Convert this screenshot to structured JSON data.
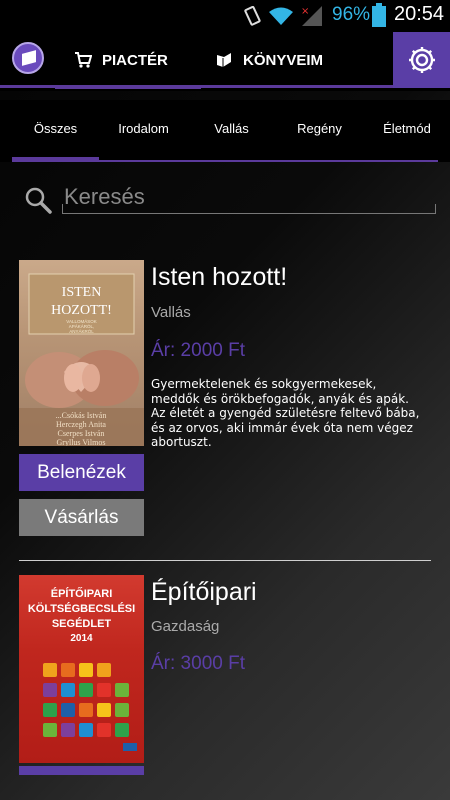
{
  "status_bar": {
    "battery_percent": "96%",
    "time": "20:54"
  },
  "action_bar": {
    "tabs": [
      {
        "label": "PIACTÉR",
        "icon": "cart-icon"
      },
      {
        "label": "KÖNYVEIM",
        "icon": "book-icon"
      }
    ],
    "settings_icon": "gear-icon"
  },
  "categories": [
    "Összes",
    "Irodalom",
    "Vallás",
    "Regény",
    "Életmód"
  ],
  "search": {
    "placeholder": "Keresés"
  },
  "books": [
    {
      "title": "Isten hozott!",
      "category": "Vallás",
      "price": "Ár: 2000 Ft",
      "description": "Gyermektelenek és sokgyermekesek, meddők és örökbefogadók, anyák és apák. Az életét a gyengéd születésre feltevő bába, és az orvos, aki immár évek óta nem végez abortuszt.",
      "preview_label": "Belenézek",
      "buy_label": "Vásárlás",
      "cover": {
        "title_line1": "ISTEN",
        "title_line2": "HOZOTT!",
        "subtitle_line1": "VALLOMÁSOK",
        "subtitle_line2": "APÁKÁRÓL,",
        "subtitle_line3": "ANYÁKRÓL",
        "authors": [
          "...Csókás István",
          "Herczegh Anita",
          "Cserpes István",
          "Gryllus Vilmos"
        ]
      }
    },
    {
      "title": "Építőipari",
      "category": "Gazdaság",
      "price": "Ár: 3000 Ft",
      "cover": {
        "title_line1": "ÉPÍTŐIPARI",
        "title_line2": "KÖLTSÉGBECSLÉSI",
        "title_line3": "SEGÉDLET",
        "year": "2014"
      }
    }
  ],
  "colors": {
    "accent": "#5a3ea6",
    "battery_text": "#33b5e5",
    "buy_button": "#7a7a7a"
  }
}
